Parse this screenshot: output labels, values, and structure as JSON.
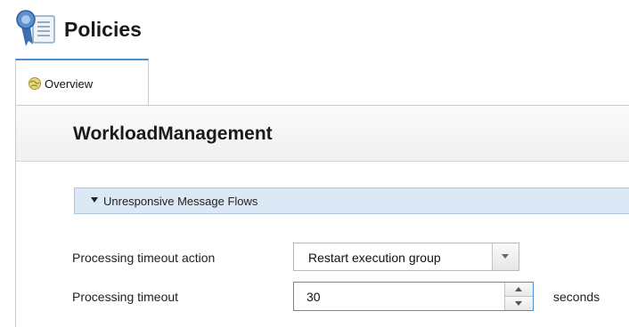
{
  "header": {
    "title": "Policies",
    "icon": "policy-ribbon-icon"
  },
  "tabs": [
    {
      "label": "Overview",
      "icon": "globe-icon",
      "active": true
    }
  ],
  "content": {
    "title": "WorkloadManagement",
    "section": {
      "label": "Unresponsive Message Flows",
      "expanded": true
    },
    "fields": {
      "timeout_action": {
        "label": "Processing timeout action",
        "value": "Restart execution group"
      },
      "timeout": {
        "label": "Processing timeout",
        "value": "30",
        "units": "seconds"
      }
    }
  },
  "colors": {
    "tab_accent": "#4a8fcf",
    "section_bar": "#dbe9f7",
    "focus_border": "#4a8fcf"
  }
}
